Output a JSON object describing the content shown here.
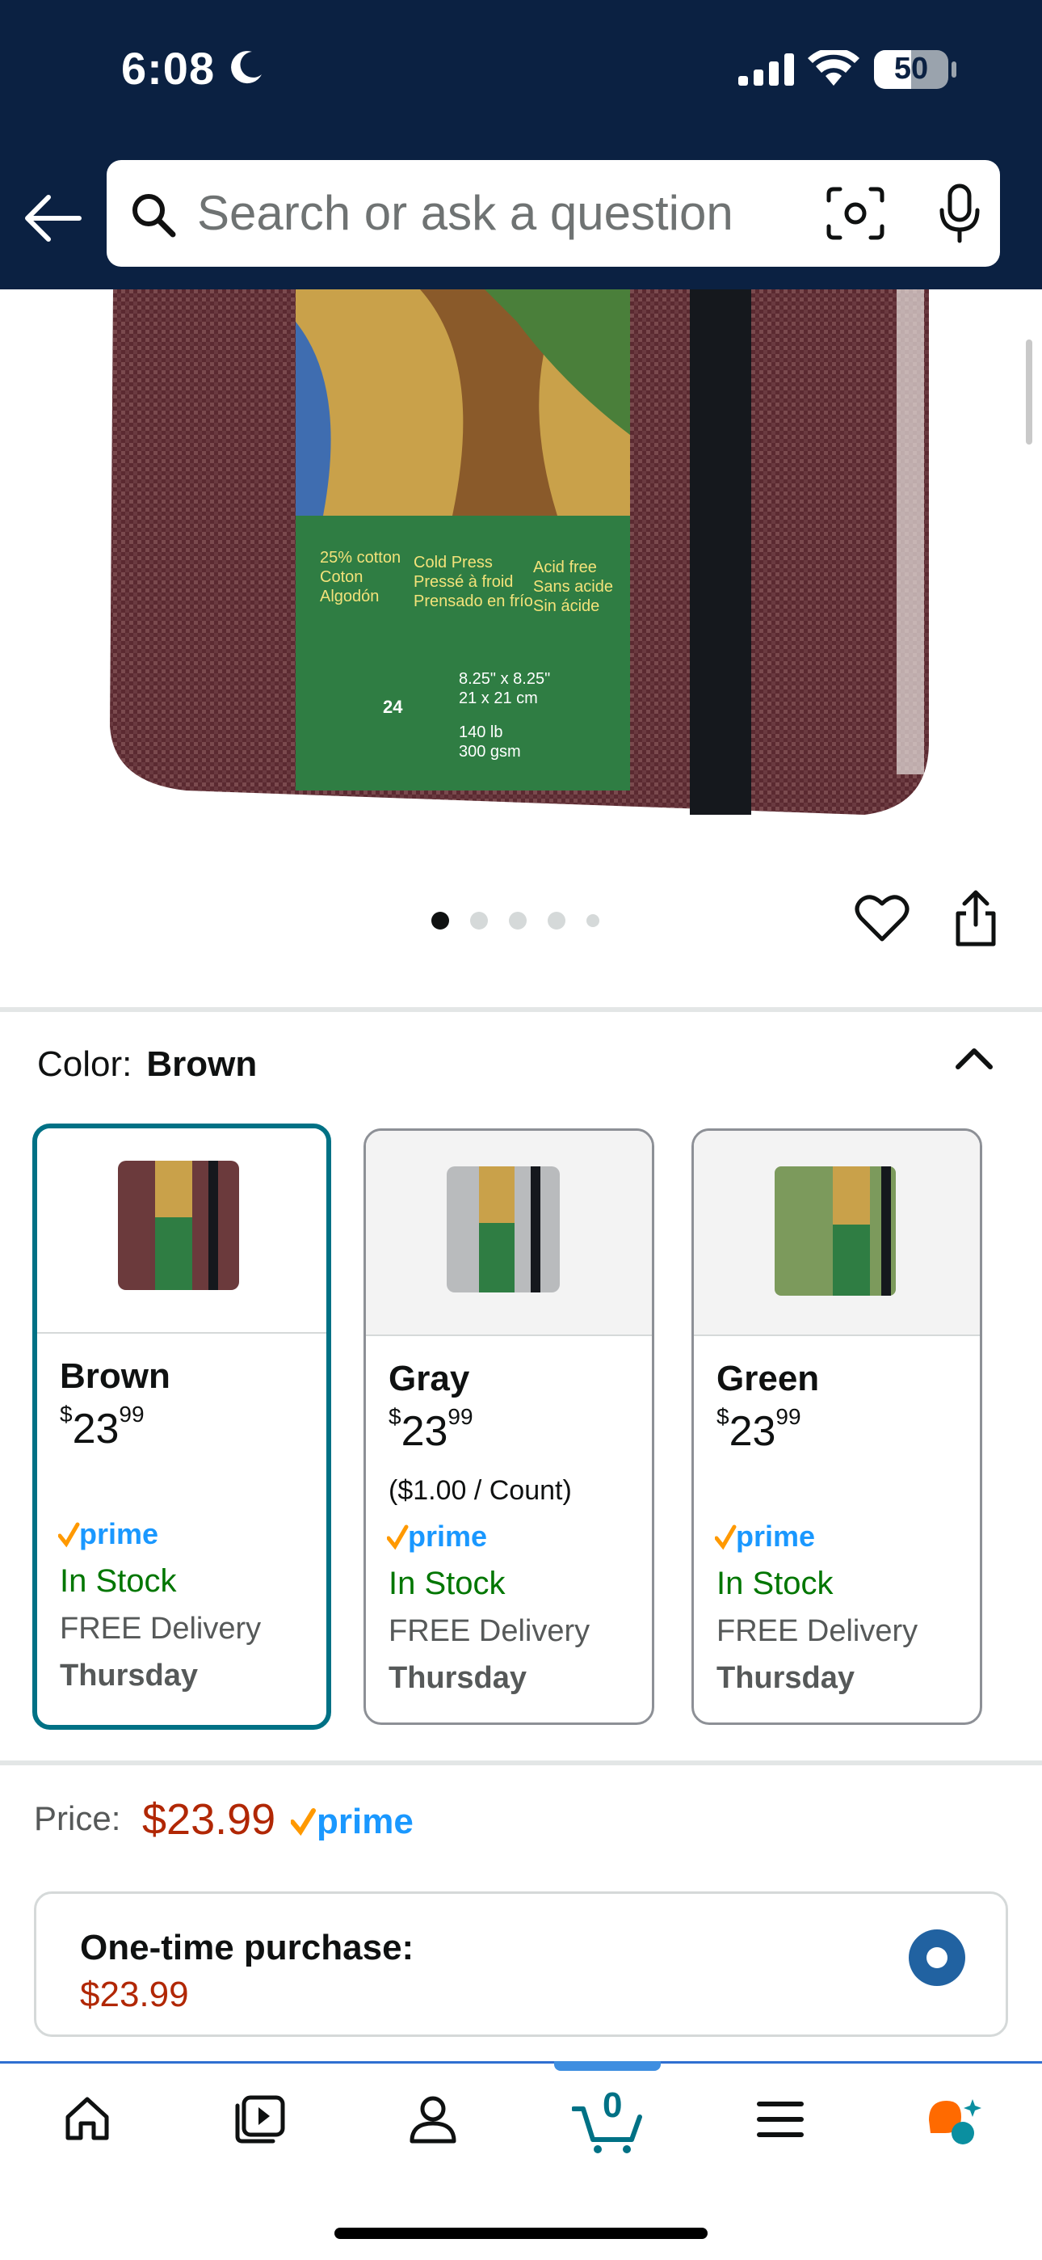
{
  "status_bar": {
    "time": "6:08",
    "battery": "50",
    "battery_level": 0.5
  },
  "search": {
    "placeholder": "Search or ask a question"
  },
  "product": {
    "cover_labels": {
      "line1": [
        "25% cotton",
        "Coton",
        "Algodón"
      ],
      "line2": [
        "Cold Press",
        "Pressé à froid",
        "Prensado en frío"
      ],
      "line3": [
        "Acid free",
        "Sans acide",
        "Sin ácide"
      ],
      "size": [
        "8.25\" x 8.25\"",
        "21 x 21 cm"
      ],
      "weight": [
        "140 lb",
        "300 gsm"
      ],
      "sheets": "24"
    },
    "carousel": {
      "total": 5,
      "active": 0
    }
  },
  "color": {
    "label": "Color:",
    "selected": "Brown"
  },
  "variants": [
    {
      "name": "Brown",
      "currency": "$",
      "price_whole": "23",
      "price_frac": "99",
      "per_unit": "",
      "prime": "prime",
      "stock": "In Stock",
      "delivery": "FREE Delivery",
      "day": "Thursday",
      "cover_color": "#6b3a3c"
    },
    {
      "name": "Gray",
      "currency": "$",
      "price_whole": "23",
      "price_frac": "99",
      "per_unit": "($1.00 / Count)",
      "prime": "prime",
      "stock": "In Stock",
      "delivery": "FREE Delivery",
      "day": "Thursday",
      "cover_color": "#b9bbbd"
    },
    {
      "name": "Green",
      "currency": "$",
      "price_whole": "23",
      "price_frac": "99",
      "per_unit": "",
      "prime": "prime",
      "stock": "In Stock",
      "delivery": "FREE Delivery",
      "day": "Thursday",
      "cover_color": "#7c9a5c"
    }
  ],
  "price": {
    "label": "Price:",
    "value": "$23.99",
    "prime": "prime"
  },
  "purchase": {
    "title": "One-time purchase:",
    "price": "$23.99"
  },
  "tabbar": {
    "cart_count": "0"
  },
  "colors": {
    "navy": "#0b2142",
    "teal": "#007185",
    "deal_red": "#b12704",
    "stock_green": "#007600",
    "prime_blue": "#1a98ff",
    "prime_check": "#ff9900"
  }
}
